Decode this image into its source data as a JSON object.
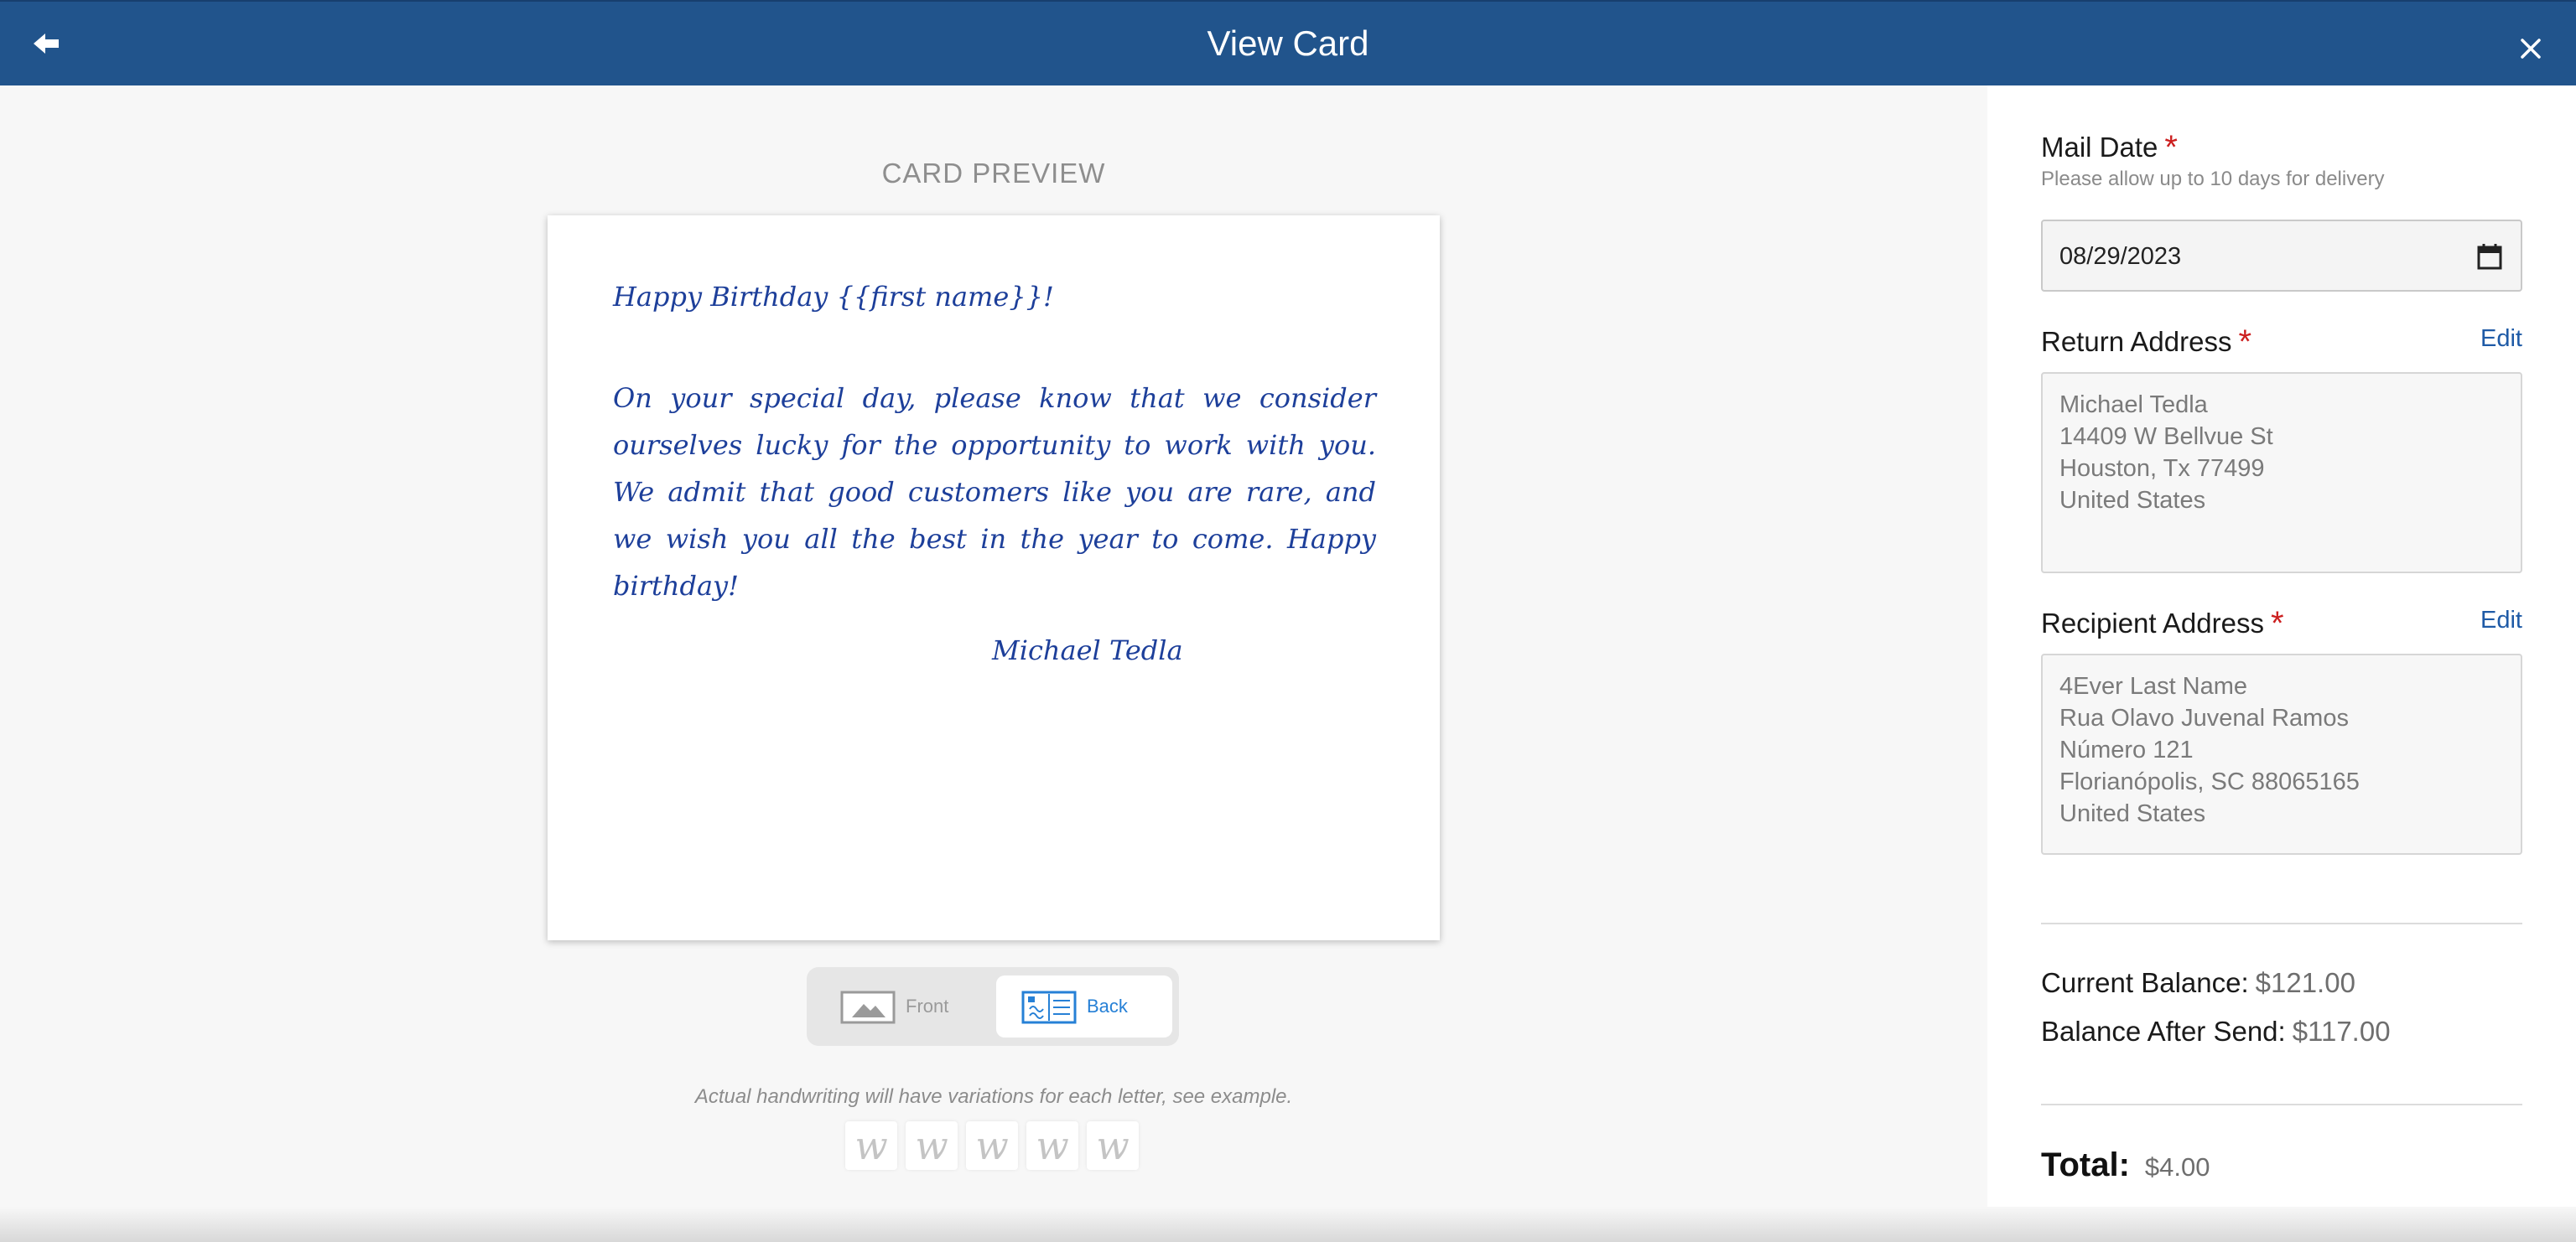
{
  "header": {
    "title": "View Card"
  },
  "preview": {
    "label": "CARD PREVIEW",
    "card": {
      "greeting": "Happy Birthday {{first name}}!",
      "body": "On your special day, please know that we consider ourselves lucky for the opportunity to work with you. We admit that good customers like you are rare, and we wish you all the best in the year to come. Happy birthday!",
      "signature": "Michael Tedla"
    },
    "toggle": {
      "front_label": "Front",
      "back_label": "Back",
      "selected": "Back"
    },
    "note": "Actual handwriting will have variations for each letter, see example.",
    "samples": [
      "w",
      "w",
      "w",
      "w",
      "w"
    ]
  },
  "panel": {
    "mail_date": {
      "label": "Mail Date",
      "required_mark": "*",
      "hint": "Please allow up to 10 days for delivery",
      "value": "08/29/2023"
    },
    "return_address": {
      "label": "Return Address",
      "required_mark": "*",
      "edit_label": "Edit",
      "lines": [
        "Michael Tedla",
        "14409 W Bellvue St",
        "Houston, Tx 77499",
        "United States"
      ]
    },
    "recipient_address": {
      "label": "Recipient Address",
      "required_mark": "*",
      "edit_label": "Edit",
      "lines": [
        "4Ever Last Name",
        "Rua Olavo Juvenal Ramos",
        "Número 121",
        "Florianópolis, SC 88065165",
        "United States"
      ]
    },
    "current_balance": {
      "label": "Current Balance:",
      "value": "$121.00"
    },
    "balance_after": {
      "label": "Balance After Send:",
      "value": "$117.00"
    },
    "total": {
      "label": "Total:",
      "value": "$4.00"
    }
  },
  "colors": {
    "header": "#21548c",
    "required": "#cc1f1f",
    "link": "#1e5aa6",
    "handwriting": "#1d3f9a"
  }
}
